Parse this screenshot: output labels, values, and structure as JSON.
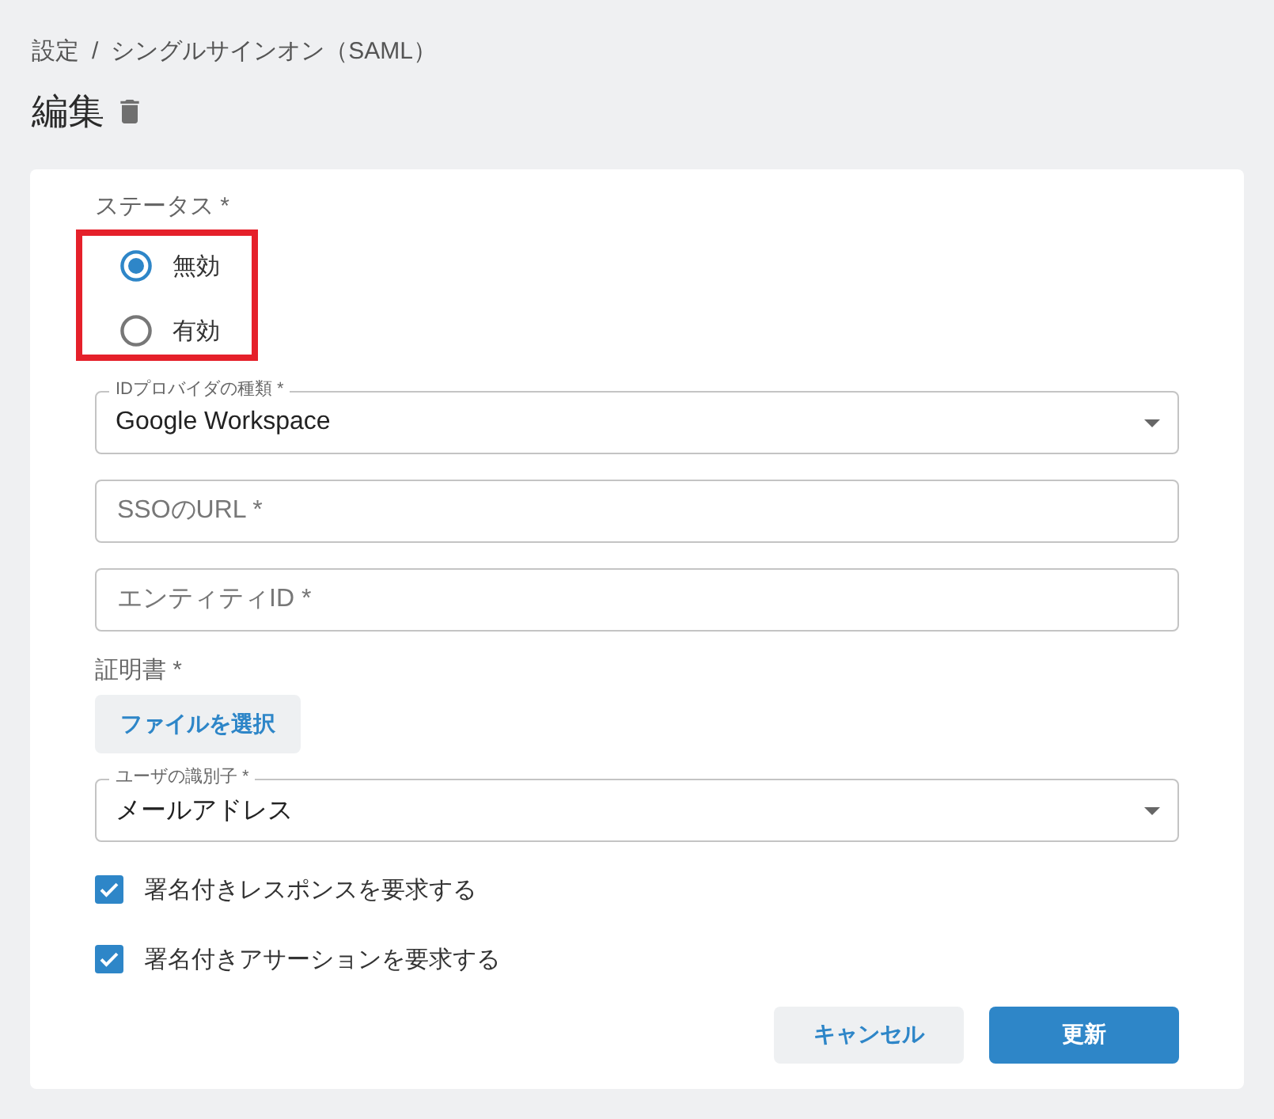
{
  "breadcrumb": {
    "items": [
      "設定",
      "シングルサインオン（SAML）"
    ],
    "separator": "/"
  },
  "title": "編集",
  "form": {
    "status": {
      "label": "ステータス *",
      "highlighted": true,
      "options": [
        {
          "label": "無効",
          "selected": true
        },
        {
          "label": "有効",
          "selected": false
        }
      ]
    },
    "fields": [
      {
        "kind": "select",
        "label": "IDプロバイダの種類 *",
        "value": "Google Workspace"
      },
      {
        "kind": "text",
        "placeholder": "SSOのURL *"
      },
      {
        "kind": "text",
        "placeholder": "エンティティID *"
      },
      {
        "kind": "file",
        "label": "証明書 *",
        "button": "ファイルを選択"
      },
      {
        "kind": "select",
        "label": "ユーザの識別子 *",
        "value": "メールアドレス"
      },
      {
        "kind": "checkbox",
        "label": "署名付きレスポンスを要求する",
        "checked": true
      },
      {
        "kind": "checkbox",
        "label": "署名付きアサーションを要求する",
        "checked": true
      }
    ],
    "buttons": [
      {
        "kind": "secondary",
        "label": "キャンセル"
      },
      {
        "kind": "primary",
        "label": "更新"
      }
    ]
  }
}
